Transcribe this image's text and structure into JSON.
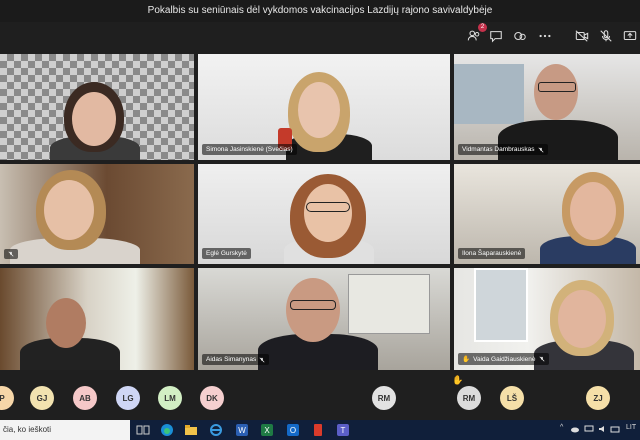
{
  "window": {
    "title": "Pokalbis su seniūnais dėl vykdomos vakcinacijos Lazdijų rajono savivaldybėje"
  },
  "toolbar": {
    "participants_badge": "2"
  },
  "tiles": [
    {
      "name": ""
    },
    {
      "name": "Simona Jasinskienė (Svečias)"
    },
    {
      "name": "Vidmantas Dambrauskas"
    },
    {
      "name": ""
    },
    {
      "name": "Eglė Gurskytė"
    },
    {
      "name": "Ilona Šaparauskienė"
    },
    {
      "name": ""
    },
    {
      "name": "Aidas Simanynas"
    },
    {
      "name": "Vaida Gaidžiauskienė"
    }
  ],
  "avatars": [
    {
      "initials": "P",
      "color": "#f6d6a8"
    },
    {
      "initials": "GJ",
      "color": "#f2e2b0"
    },
    {
      "initials": "AB",
      "color": "#f5c8c8"
    },
    {
      "initials": "LG",
      "color": "#cfd6f5"
    },
    {
      "initials": "LM",
      "color": "#d2efc4"
    },
    {
      "initials": "DK",
      "color": "#f5cfcf"
    },
    {
      "initials": "RM",
      "color": "#e2e2e2"
    },
    {
      "initials": "RM",
      "color": "#dcdcdc"
    },
    {
      "initials": "LŠ",
      "color": "#f5dfa8"
    },
    {
      "initials": "ZJ",
      "color": "#f5dfa8"
    }
  ],
  "taskbar": {
    "search_text": "čia, ko ieškoti",
    "lang": "LIT"
  }
}
